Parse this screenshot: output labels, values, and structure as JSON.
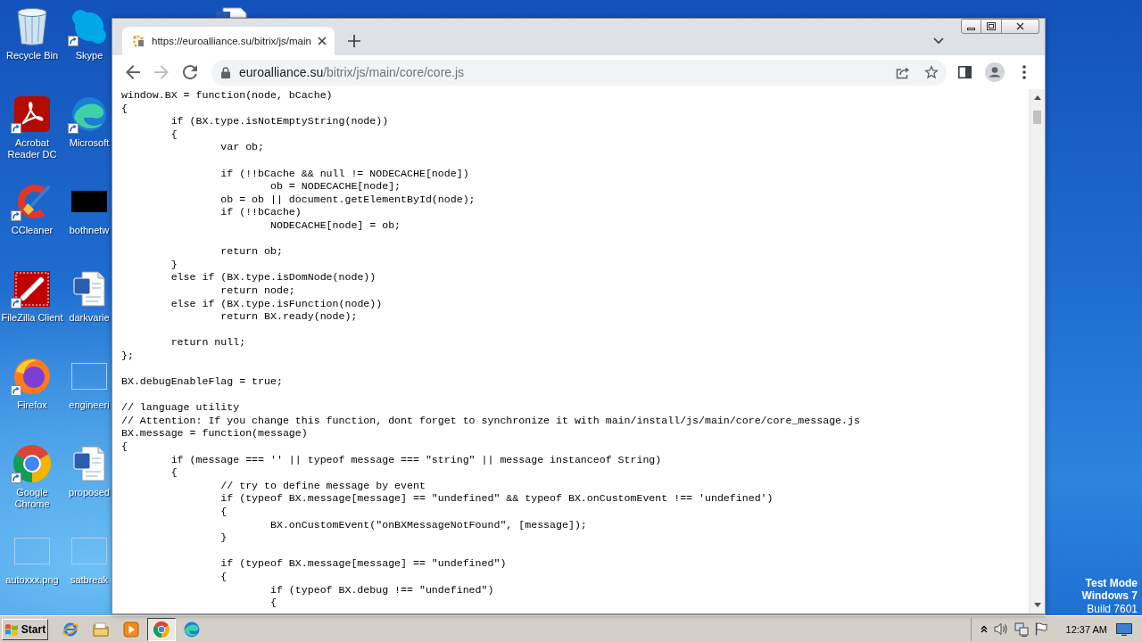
{
  "desktop": {
    "icons": [
      {
        "label": "Recycle Bin",
        "kind": "bin",
        "shortcut": false
      },
      {
        "label": "Acrobat Reader DC",
        "kind": "pdf",
        "shortcut": true
      },
      {
        "label": "CCleaner",
        "kind": "brush",
        "shortcut": true
      },
      {
        "label": "FileZilla Client",
        "kind": "ftp",
        "shortcut": true
      },
      {
        "label": "Firefox",
        "kind": "fox",
        "shortcut": true
      },
      {
        "label": "Google Chrome",
        "kind": "wheel",
        "shortcut": true
      },
      {
        "label": "autoxxx.png",
        "kind": "picture",
        "shortcut": false
      },
      {
        "label": "Skype",
        "kind": "bubble",
        "shortcut": true
      },
      {
        "label": "Microsoft",
        "kind": "swirl",
        "shortcut": true
      },
      {
        "label": "bothnetw",
        "kind": "dark-image",
        "shortcut": false
      },
      {
        "label": "darkvarie",
        "kind": "document",
        "shortcut": false
      },
      {
        "label": "engineeri",
        "kind": "picture",
        "shortcut": false
      },
      {
        "label": "proposed",
        "kind": "document",
        "shortcut": false
      },
      {
        "label": "satbreak",
        "kind": "picture",
        "shortcut": false
      }
    ],
    "notice": [
      {
        "text": "Test Mode",
        "bold": true
      },
      {
        "text": "Windows 7",
        "bold": true
      },
      {
        "text": "Build 7601",
        "bold": false
      }
    ]
  },
  "browser": {
    "tabs": [
      {
        "title": "https://euroalliance.su/bitrix/js/main",
        "selected": true
      }
    ],
    "navigation": {
      "back_disabled": false,
      "forward_disabled": true
    },
    "address": {
      "host": "euroalliance.su",
      "path": "/bitrix/js/main/core/core.js"
    },
    "code_blocks": [
      [
        "window.BX = function(node, bCache)",
        "{",
        "\tif (BX.type.isNotEmptyString(node))",
        "\t{",
        "\t\tvar ob;"
      ],
      [
        "\t\tif (!!bCache && null != NODECACHE[node])",
        "\t\t\tob = NODECACHE[node];",
        "\t\tob = ob || document.getElementById(node);",
        "\t\tif (!!bCache)",
        "\t\t\tNODECACHE[node] = ob;"
      ],
      [
        "\t\treturn ob;",
        "\t}",
        "\telse if (BX.type.isDomNode(node))",
        "\t\treturn node;",
        "\telse if (BX.type.isFunction(node))",
        "\t\treturn BX.ready(node);"
      ],
      [
        "\treturn null;",
        "};"
      ],
      [
        "BX.debugEnableFlag = true;"
      ],
      [
        "// language utility",
        "// Attention: If you change this function, dont forget to synchronize it with main/install/js/main/core/core_message.js",
        "BX.message = function(message)",
        "{",
        "\tif (message === '' || typeof message === \"string\" || message instanceof String)",
        "\t{",
        "\t\t// try to define message by event",
        "\t\tif (typeof BX.message[message] == \"undefined\" && typeof BX.onCustomEvent !== 'undefined')",
        "\t\t{",
        "\t\t\tBX.onCustomEvent(\"onBXMessageNotFound\", [message]);",
        "\t\t}"
      ],
      [
        "\t\tif (typeof BX.message[message] == \"undefined\")",
        "\t\t{",
        "\t\t\tif (typeof BX.debug !== \"undefined\")",
        "\t\t\t{"
      ]
    ]
  },
  "taskbar": {
    "start_label": "Start",
    "pinned": [
      {
        "kind": "ie",
        "selected": false
      },
      {
        "kind": "folder",
        "selected": false
      },
      {
        "kind": "media",
        "selected": false
      },
      {
        "kind": "chrome",
        "selected": true
      },
      {
        "kind": "edge",
        "selected": false
      }
    ],
    "clock": "12:37 AM"
  }
}
